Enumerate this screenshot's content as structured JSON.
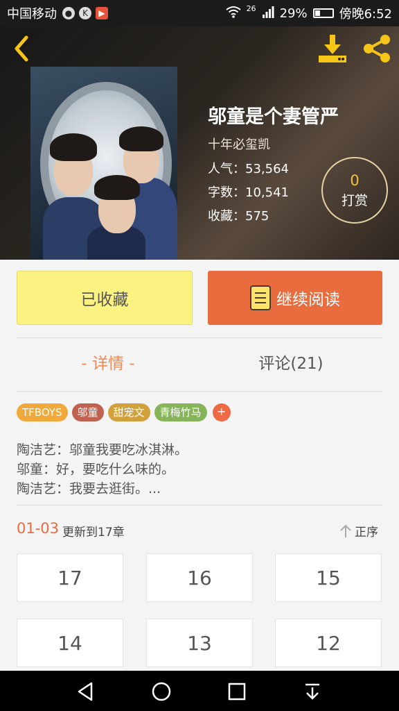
{
  "status_bar": {
    "carrier": "中国移动",
    "network": "26",
    "battery": "29%",
    "battery_level": 0.29,
    "time": "傍晚6:52"
  },
  "book": {
    "title": "邬童是个妻管严",
    "author": "十年必玺凯",
    "popularity": "人气：53,564",
    "word_count": "字数：10,541",
    "favorites": "收藏：575"
  },
  "reward": {
    "count": "0",
    "label": "打赏"
  },
  "actions": {
    "collected_label": "已收藏",
    "read_label": "继续阅读"
  },
  "tabs": [
    {
      "label": "- 详情 -"
    },
    {
      "label": "评论(21)"
    }
  ],
  "tags": [
    {
      "label": "TFBOYS",
      "color": "#f1a93c"
    },
    {
      "label": "邬童",
      "color": "#c0624f"
    },
    {
      "label": "甜宠文",
      "color": "#d2a13c"
    },
    {
      "label": "青梅竹马",
      "color": "#86b559"
    }
  ],
  "add_tag_label": "+",
  "description": [
    "陶洁艺：邬童我要吃冰淇淋。",
    "邬童：好，要吃什么味的。",
    "陶洁艺：我要去逛街。..."
  ],
  "chapters_header": {
    "date": "01-03",
    "update_text": "更新到17章",
    "sort_label": "正序"
  },
  "chapters": [
    "17",
    "16",
    "15",
    "14",
    "13",
    "12"
  ],
  "icons": {
    "back": "chevron-left-icon",
    "download": "download-icon",
    "share": "share-icon",
    "read": "book-icon",
    "sort": "arrow-up-icon",
    "nav": [
      "back-triangle-icon",
      "home-circle-icon",
      "recents-square-icon",
      "notification-pulldown-icon"
    ]
  },
  "colors": {
    "accent": "#e96c3f",
    "collected_bg": "#fcf281",
    "reward_count": "#f2c230",
    "tab_active": "#ee8a57"
  }
}
